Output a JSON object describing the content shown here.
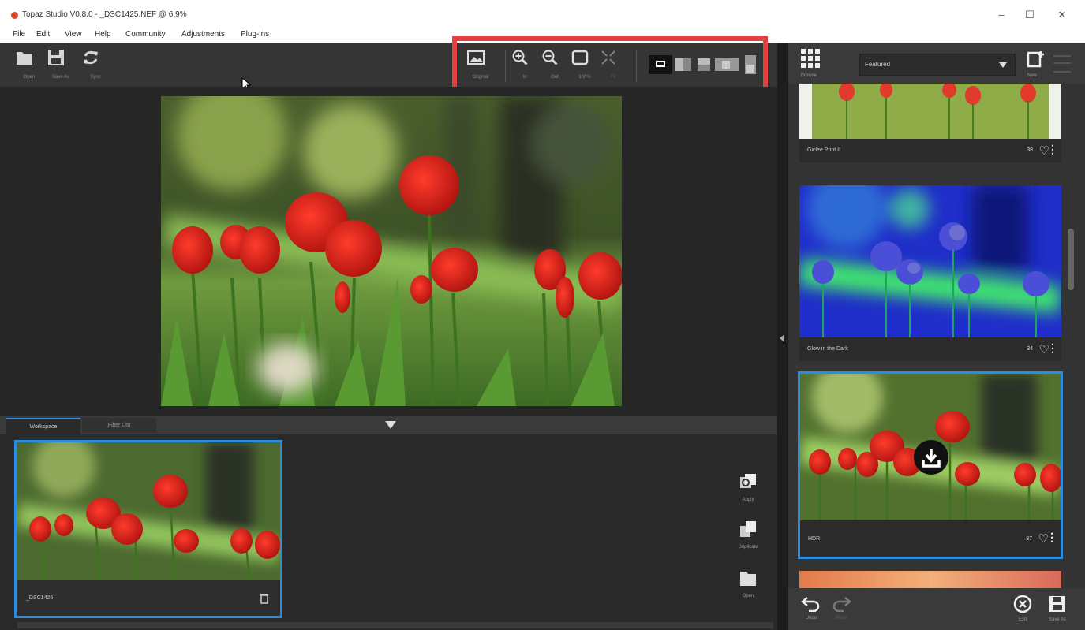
{
  "window": {
    "title": "Topaz Studio V0.8.0 - _DSC1425.NEF @ 6.9%",
    "minimize": "–",
    "maximize": "☐",
    "close": "✕"
  },
  "menu": [
    "File",
    "Edit",
    "View",
    "Help",
    "Community",
    "Adjustments",
    "Plug-ins"
  ],
  "toolbar": {
    "open_label": "Open",
    "save_label": "Save As",
    "sync_label": "Sync"
  },
  "view_controls": {
    "original": "Original",
    "zoom_in": "In",
    "zoom_out": "Out",
    "fit": "100%",
    "fill": "Fit"
  },
  "tabs": {
    "workspace": "Workspace",
    "filter_list": "Filter List"
  },
  "thumbnail": {
    "filename": "_DSC1425"
  },
  "side_actions": {
    "apply": "Apply",
    "duplicate": "Duplicate",
    "open": "Open"
  },
  "browser": {
    "browse_label": "Browse",
    "filter": "Featured",
    "new_label": "New",
    "cards": [
      {
        "name": "Giclee Print II",
        "likes": "38"
      },
      {
        "name": "Glow in the Dark",
        "likes": "34"
      },
      {
        "name": "HDR",
        "likes": "87"
      }
    ]
  },
  "footer": {
    "undo": "Undo",
    "redo": "Redo",
    "exit": "Exit",
    "save_as": "Save As"
  },
  "colors": {
    "highlight": "#e2413d",
    "selection": "#2a8de0"
  }
}
